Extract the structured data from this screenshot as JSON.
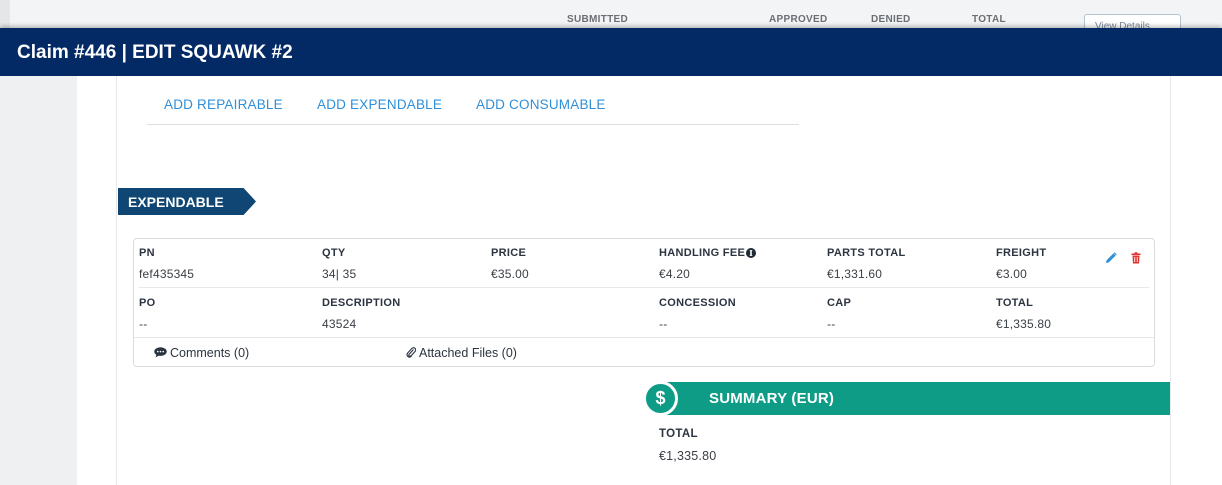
{
  "background": {
    "columns": [
      "SUBMITTED",
      "APPROVED",
      "DENIED",
      "TOTAL"
    ],
    "button_label": "View Details"
  },
  "modal": {
    "title": "Claim #446 | EDIT SQUAWK #2"
  },
  "add_links": {
    "repairable": "ADD REPAIRABLE",
    "expendable": "ADD EXPENDABLE",
    "consumable": "ADD CONSUMABLE"
  },
  "section": {
    "title": "EXPENDABLE"
  },
  "item": {
    "pn": {
      "label": "PN",
      "value": "fef435345"
    },
    "qty": {
      "label": "QTY",
      "value": "34| 35"
    },
    "price": {
      "label": "PRICE",
      "value": "€35.00"
    },
    "handling_fee": {
      "label": "HANDLING FEE",
      "value": "€4.20"
    },
    "parts_total": {
      "label": "PARTS TOTAL",
      "value": "€1,331.60"
    },
    "freight": {
      "label": "FREIGHT",
      "value": "€3.00"
    },
    "po": {
      "label": "PO",
      "value": "--"
    },
    "description": {
      "label": "DESCRIPTION",
      "value": "43524"
    },
    "concession": {
      "label": "CONCESSION",
      "value": "--"
    },
    "cap": {
      "label": "CAP",
      "value": "--"
    },
    "total": {
      "label": "TOTAL",
      "value": "€1,335.80"
    },
    "comments_label": "Comments (0)",
    "attachments_label": "Attached Files (0)",
    "edit_icon_color": "#2f8fd8",
    "delete_icon_color": "#e0322f"
  },
  "summary": {
    "title": "SUMMARY (EUR)",
    "total_label": "TOTAL",
    "total_value": "€1,335.80",
    "accent_color": "#0e9c87"
  }
}
